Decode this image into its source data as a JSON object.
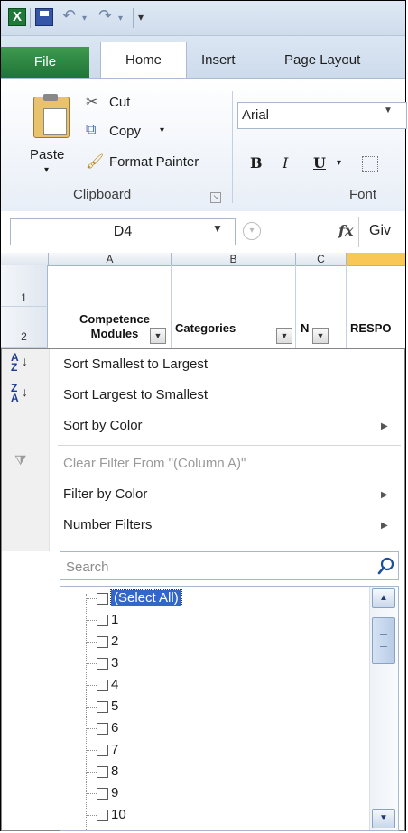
{
  "app": {
    "logo_letter": "X"
  },
  "ribbon": {
    "tabs": {
      "file": "File",
      "home": "Home",
      "insert": "Insert",
      "page_layout": "Page Layout"
    },
    "clipboard": {
      "paste": "Paste",
      "cut": "Cut",
      "copy": "Copy",
      "format_painter": "Format Painter",
      "group_label": "Clipboard"
    },
    "font": {
      "font_name": "Arial",
      "group_label": "Font",
      "bold": "B",
      "italic": "I",
      "underline": "U"
    }
  },
  "formula_bar": {
    "name_box": "D4",
    "fx": "fx",
    "formula": "Giv"
  },
  "sheet": {
    "columns": [
      "A",
      "B",
      "C"
    ],
    "rows": [
      "1",
      "2"
    ],
    "headers": {
      "col_a": "Competence Modules",
      "col_b": "Categories",
      "col_c": "N",
      "col_d": "RESPO"
    }
  },
  "filter_menu": {
    "sort_asc": "Sort Smallest to Largest",
    "sort_desc": "Sort Largest to Smallest",
    "sort_color": "Sort by Color",
    "clear_filter": "Clear Filter From \"(Column A)\"",
    "filter_color": "Filter by Color",
    "number_filters": "Number Filters",
    "search_placeholder": "Search",
    "items": [
      "(Select All)",
      "1",
      "2",
      "3",
      "4",
      "5",
      "6",
      "7",
      "8",
      "9",
      "10"
    ]
  },
  "colors": {
    "accent_green": "#1f7438",
    "selection_blue": "#3267c9",
    "active_col": "#f9c756"
  }
}
